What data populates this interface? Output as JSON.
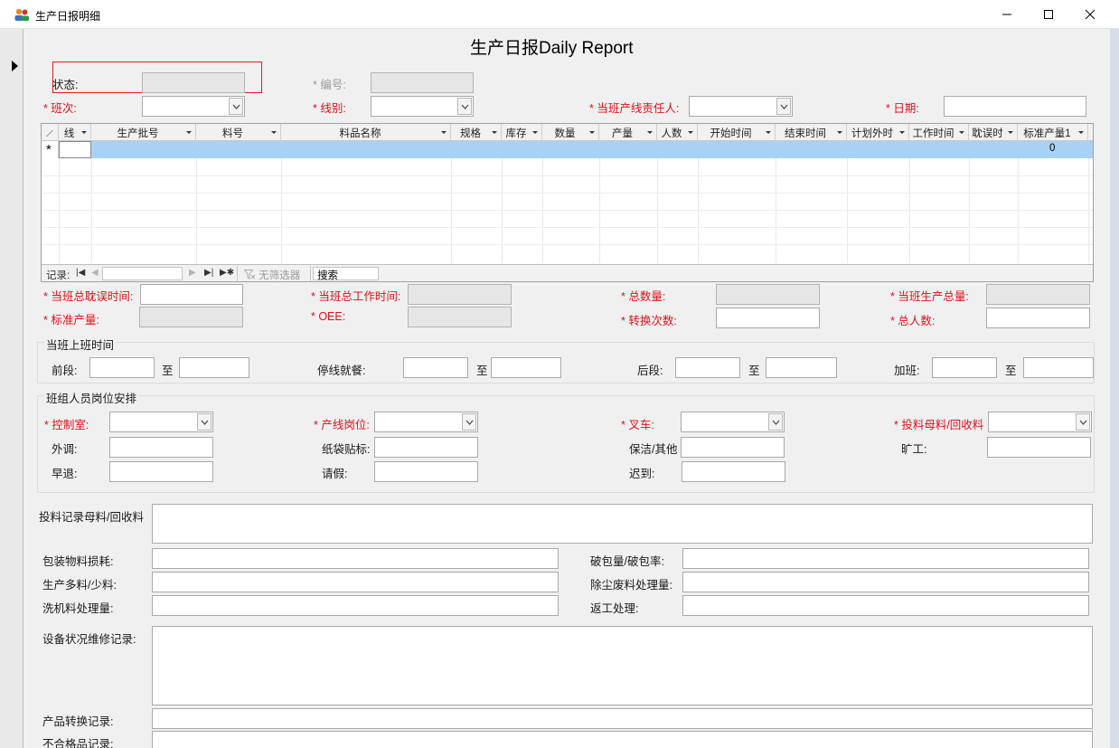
{
  "window": {
    "title": "生产日报明细"
  },
  "form": {
    "title": "生产日报Daily Report",
    "status_label": "状态:",
    "status_value": "",
    "number_label": "* 编号:",
    "number_value": "",
    "shift_label": "* 班次:",
    "line_label": "* 线别:",
    "leader_label": "* 当班产线责任人:",
    "date_label": "* 日期:",
    "date_value": ""
  },
  "sheet": {
    "columns": [
      "线",
      "生产批号",
      "料号",
      "料品名称",
      "规格",
      "库存",
      "数量",
      "产量",
      "人数",
      "开始时间",
      "结束时间",
      "计划外时",
      "工作时间",
      "耽误时",
      "标准产量1"
    ],
    "new_row_marker": "*",
    "new_row_standard_output": "0",
    "nav": {
      "record_label": "记录:",
      "filter_label": "无筛选器",
      "search_label": "搜索"
    }
  },
  "totals": {
    "delay_time_label": "* 当班总耽误时间:",
    "work_time_label": "* 当班总工作时间:",
    "total_qty_label": "* 总数量:",
    "total_output_label": "* 当班生产总量:",
    "std_output_label": "* 标准产量:",
    "oee_label": "* OEE:",
    "changeover_label": "* 转换次数:",
    "headcount_label": "* 总人数:"
  },
  "shift_time": {
    "group_title": "当班上班时间",
    "front_label": "前段:",
    "meal_label": "停线就餐:",
    "back_label": "后段:",
    "overtime_label": "加班:",
    "to_label": "至"
  },
  "staffing": {
    "group_title": "班组人员岗位安排",
    "control_room_label": "* 控制室:",
    "line_post_label": "* 产线岗位:",
    "forklift_label": "* 叉车:",
    "feeding_label": "* 投料母料/回收料",
    "transfer_label": "外调:",
    "bag_label": "纸袋贴标:",
    "cleaning_label": "保洁/其他",
    "absent_label": "旷工:",
    "early_leave_label": "早退:",
    "leave_label": "请假:",
    "late_label": "迟到:"
  },
  "records": {
    "feeding_record_label": "投料记录母料/回收料",
    "pack_loss_label": "包装物料损耗:",
    "broken_bag_label": "破包量/破包率:",
    "over_under_label": "生产多料/少料:",
    "dust_waste_label": "除尘废料处理量:",
    "wash_machine_label": "洗机料处理量:",
    "rework_label": "返工处理:",
    "maintenance_label": "设备状况维修记录:",
    "changeover_record_label": "产品转换记录:",
    "nonconforming_label": "不合格品记录:"
  },
  "colors": {
    "required": "#e0101a",
    "selection": "#a9d1f5",
    "highlight_border": "#e01a22"
  }
}
